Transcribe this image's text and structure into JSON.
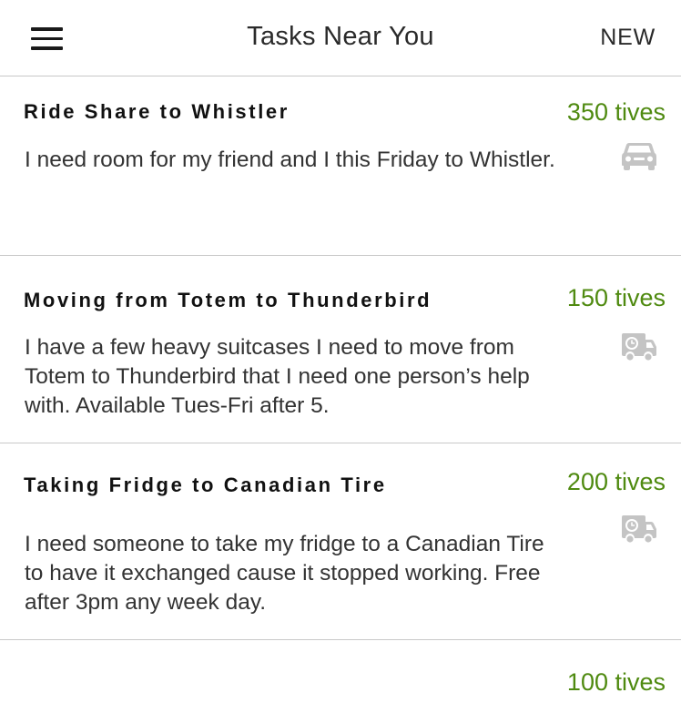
{
  "header": {
    "title": "Tasks Near You",
    "new_label": "NEW"
  },
  "tasks": [
    {
      "title": "Ride Share to Whistler",
      "price": "350 tives",
      "description": "I need room for my friend and I this Friday to Whistler.",
      "icon": "car-icon"
    },
    {
      "title": "Moving from Totem to Thunderbird",
      "price": "150 tives",
      "description": "I have a few heavy suitcases I need to move from Totem to Thunderbird that I need one person’s help with. Available Tues-Fri after 5.",
      "icon": "delivery-truck-icon"
    },
    {
      "title": "Taking Fridge to Canadian Tire",
      "price": "200 tives",
      "description": "I need someone to take my fridge to a Canadian Tire to have it exchanged cause it stopped working. Free after 3pm any week day.",
      "icon": "delivery-truck-icon"
    },
    {
      "price": "100 tives"
    }
  ],
  "colors": {
    "price": "#4f8a10",
    "divider": "#c8c8c8",
    "icon": "#c4c4c4"
  }
}
